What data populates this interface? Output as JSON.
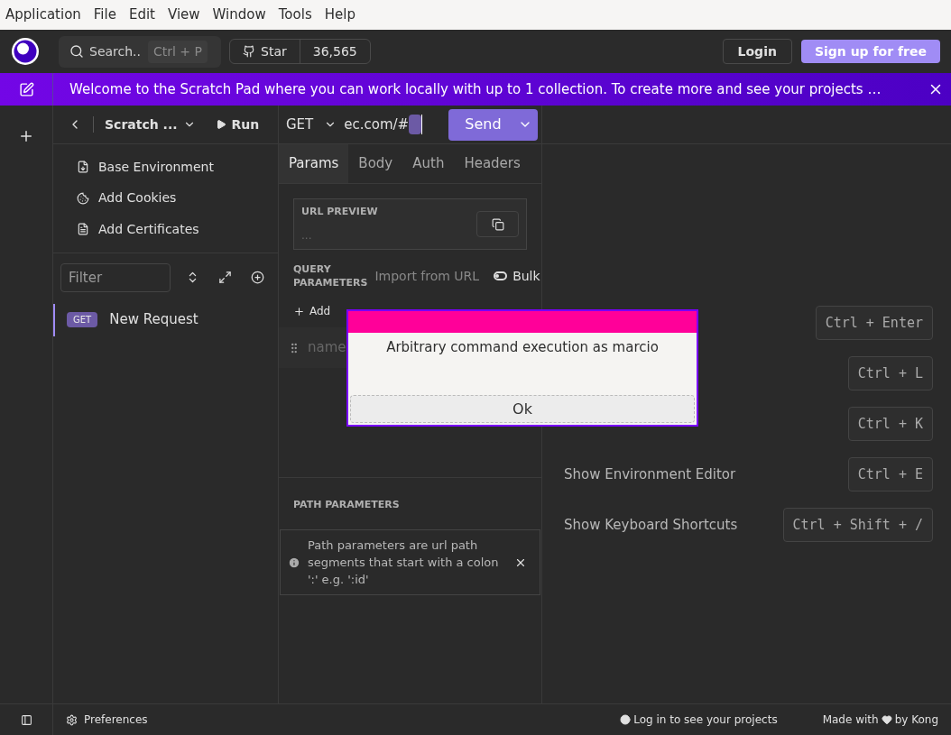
{
  "menu_bar": [
    "Application",
    "File",
    "Edit",
    "View",
    "Window",
    "Tools",
    "Help"
  ],
  "header": {
    "search": {
      "placeholder": "Search..",
      "shortcut": "Ctrl + P"
    },
    "star": {
      "label": "Star",
      "count": "36,565"
    },
    "login": "Login",
    "signup": "Sign up for free"
  },
  "banner": {
    "text": "Welcome to the Scratch Pad where you can work locally with up to 1 collection. To create more and see your projects …"
  },
  "sidebar": {
    "project": "Scratch ...",
    "run": "Run",
    "items": [
      {
        "kind": "environment",
        "label": "Base Environment"
      },
      {
        "kind": "cookies",
        "label": "Add Cookies"
      },
      {
        "kind": "certificates",
        "label": "Add Certificates"
      }
    ],
    "filter": {
      "placeholder": "Filter"
    },
    "requests": [
      {
        "method": "GET",
        "name": "New Request",
        "selected": true
      }
    ]
  },
  "request": {
    "method": "GET",
    "url": "ec.com/#",
    "send": "Send",
    "tabs": [
      {
        "label": "Params",
        "selected": true
      },
      {
        "label": "Body",
        "selected": false
      },
      {
        "label": "Auth",
        "selected": false
      },
      {
        "label": "Headers",
        "selected": false
      }
    ],
    "url_preview": {
      "label": "URL PREVIEW",
      "value": "..."
    },
    "query_parameters": {
      "label": "QUERY PARAMETERS",
      "import": "Import from URL",
      "bulk": {
        "label": "Bulk",
        "on": false
      },
      "add": "Add",
      "name_placeholder": "name"
    },
    "path_parameters": {
      "label": "PATH PARAMETERS",
      "note": "Path parameters are url path segments that start with a colon ':' e.g. ':id'"
    }
  },
  "shortcuts": [
    {
      "keys": "Ctrl + Enter"
    },
    {
      "keys": "Ctrl + L"
    },
    {
      "keys": "Ctrl + K"
    },
    {
      "label": "Show Environment Editor",
      "keys": "Ctrl + E"
    },
    {
      "label": "Show Keyboard Shortcuts",
      "keys": "Ctrl + Shift + /"
    }
  ],
  "footer": {
    "preferences": "Preferences",
    "login_prompt": "Log in to see your projects",
    "made_with": "Made with",
    "by": "by Kong"
  },
  "dialog": {
    "message": "Arbitrary command execution as marcio",
    "button": "Ok"
  }
}
